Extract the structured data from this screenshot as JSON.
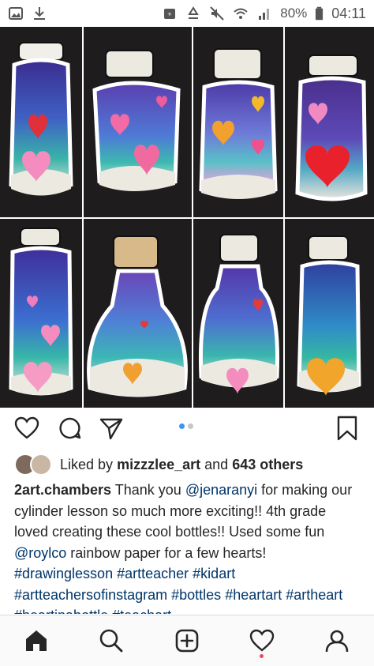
{
  "status": {
    "battery": "80%",
    "time": "04:11"
  },
  "post": {
    "likes": {
      "liked_by_prefix": "Liked by",
      "liked_by_user": "mizzzlee_art",
      "and_text": "and",
      "others_count": "643 others"
    },
    "caption": {
      "username": "2art.chambers",
      "parts": [
        {
          "text": " Thank you ",
          "type": "text"
        },
        {
          "text": "@jenaranyi",
          "type": "link"
        },
        {
          "text": " for making our cylinder lesson so much more exciting!! 4th grade loved creating these cool bottles!! Used some fun ",
          "type": "text"
        },
        {
          "text": "@roylco",
          "type": "link"
        },
        {
          "text": " rainbow paper for a few hearts! ",
          "type": "text"
        },
        {
          "text": "#drawinglesson",
          "type": "link"
        },
        {
          "text": " ",
          "type": "text"
        },
        {
          "text": "#artteacher",
          "type": "link"
        },
        {
          "text": " ",
          "type": "text"
        },
        {
          "text": "#kidart",
          "type": "link"
        },
        {
          "text": " ",
          "type": "text"
        },
        {
          "text": "#artteachersofinstagram",
          "type": "link"
        },
        {
          "text": " ",
          "type": "text"
        },
        {
          "text": "#bottles",
          "type": "link"
        },
        {
          "text": " ",
          "type": "text"
        },
        {
          "text": "#heartart",
          "type": "link"
        },
        {
          "text": " ",
          "type": "text"
        },
        {
          "text": "#artheart",
          "type": "link"
        },
        {
          "text": " ",
          "type": "text"
        },
        {
          "text": "#heartinabottle",
          "type": "link"
        },
        {
          "text": " ",
          "type": "text"
        },
        {
          "text": "#teachart",
          "type": "link"
        }
      ]
    },
    "carousel": {
      "count": 2,
      "active": 0
    }
  },
  "icons": {
    "statusbar_left": [
      "image-icon",
      "download-icon"
    ],
    "statusbar_right": [
      "data-saver-icon",
      "recycle-icon",
      "mute-icon",
      "wifi-icon",
      "signal-icon",
      "battery-icon"
    ],
    "actions": [
      "heart-icon",
      "comment-icon",
      "share-icon",
      "bookmark-icon"
    ],
    "bottom_nav": [
      "home-icon",
      "search-icon",
      "add-post-icon",
      "activity-heart-icon",
      "profile-icon"
    ]
  },
  "colors": {
    "link": "#003569",
    "text": "#262626",
    "carousel_active": "#3897f0",
    "carousel_inactive": "#c7c7c7",
    "notification": "#ed4956",
    "artwork_background": "#1e1c1d"
  }
}
